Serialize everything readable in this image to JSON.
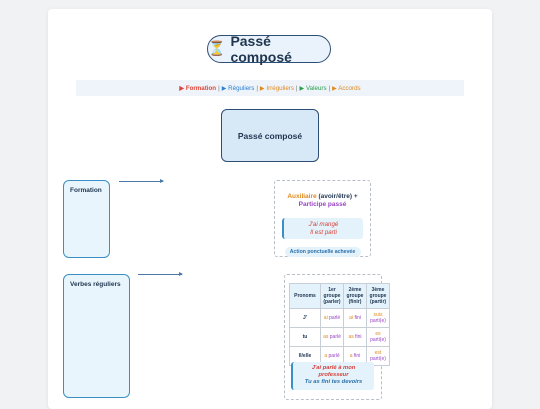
{
  "colors": {
    "accent_dark": "#2f4e73",
    "auxiliary": "#e08a1e",
    "participle": "#9a44c4",
    "example_red": "#d9403a",
    "action_blue": "#2a6fa8",
    "nav_formation": "#e0463c",
    "nav_reguliers": "#2a7fd4",
    "nav_irreguliers": "#e08a1e",
    "nav_valeurs": "#2a9d4a",
    "nav_accords": "#e08a1e"
  },
  "title": {
    "icon": "hourglass-icon",
    "glyph": "⏳",
    "text": "Passé composé"
  },
  "nav": {
    "items": [
      {
        "label": "Formation",
        "color": "#e0463c",
        "bold": true
      },
      {
        "label": "Réguliers",
        "color": "#2a7fd4",
        "bold": false
      },
      {
        "label": "Irréguliers",
        "color": "#e08a1e",
        "bold": false
      },
      {
        "label": "Valeurs",
        "color": "#2a9d4a",
        "bold": false
      },
      {
        "label": "Accords",
        "color": "#e08a1e",
        "bold": false
      }
    ],
    "separator": "|",
    "arrow": "▶"
  },
  "main_node": {
    "label": "Passé composé"
  },
  "formation": {
    "label": "Formation",
    "aux_word": "Auxiliaire",
    "aux_rest": "(avoir/être) +",
    "participle": "Participe passé",
    "examples": [
      "J'ai mangé",
      "Il est parti"
    ],
    "badge": "Action ponctuelle achevée"
  },
  "reguliers": {
    "label": "Verbes réguliers",
    "table": {
      "headers": [
        "Pronoms",
        "1er groupe (parler)",
        "2ème groupe (finir)",
        "3ème groupe (partir)"
      ],
      "rows": [
        {
          "pronoun": "J'",
          "g1_aux": "ai",
          "g1_part": "parlé",
          "g2_aux": "ai",
          "g2_part": "fini",
          "g3_aux": "suis",
          "g3_part": "parti(e)"
        },
        {
          "pronoun": "tu",
          "g1_aux": "as",
          "g1_part": "parlé",
          "g2_aux": "as",
          "g2_part": "fini",
          "g3_aux": "es",
          "g3_part": "parti(e)"
        },
        {
          "pronoun": "Il/elle",
          "g1_aux": "a",
          "g1_part": "parlé",
          "g2_aux": "a",
          "g2_part": "fini",
          "g3_aux": "est",
          "g3_part": "parti(e)"
        }
      ]
    },
    "example_lines": [
      "J'ai parlé à mon",
      "professeur",
      "Tu as fini tes devoirs"
    ]
  }
}
